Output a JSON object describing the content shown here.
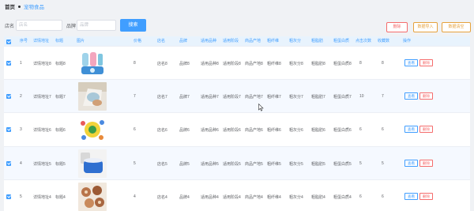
{
  "breadcrumb": {
    "home": "首页",
    "current": "宠物食品"
  },
  "search": {
    "label1": "店名",
    "placeholder1": "店名",
    "label2": "品牌",
    "placeholder2": "品牌",
    "button": "搜索"
  },
  "toolbar": {
    "delete": "删除",
    "import": "数据导入",
    "clear": "数据清空"
  },
  "columns": [
    "序号",
    "详情地址",
    "标题",
    "图片",
    "价格",
    "店名",
    "品牌",
    "适用品种",
    "适用阶段",
    "商品产地",
    "粗纤维",
    "粗灰分",
    "粗脂肪",
    "粗蛋白质",
    "点击次数",
    "收藏数",
    "操作"
  ],
  "actions": {
    "view": "查看",
    "delete": "删除"
  },
  "rows": [
    {
      "index": "1",
      "address": "详情地址8",
      "title": "标题8",
      "price": "8",
      "shop": "店名8",
      "brand": "品牌8",
      "breed": "适用品种8",
      "stage": "适用阶段8",
      "origin": "商品产地8",
      "fiber": "粗纤维8",
      "ash": "粗灰分8",
      "fat": "粗脂肪8",
      "protein": "粗蛋白质8",
      "clicks": "8",
      "favorites": "8"
    },
    {
      "index": "2",
      "address": "详情地址7",
      "title": "标题7",
      "price": "7",
      "shop": "店名7",
      "brand": "品牌7",
      "breed": "适用品种7",
      "stage": "适用阶段7",
      "origin": "商品产地7",
      "fiber": "粗纤维7",
      "ash": "粗灰分7",
      "fat": "粗脂肪7",
      "protein": "粗蛋白质7",
      "clicks": "10",
      "favorites": "7"
    },
    {
      "index": "3",
      "address": "详情地址6",
      "title": "标题6",
      "price": "6",
      "shop": "店名6",
      "brand": "品牌6",
      "breed": "适用品种6",
      "stage": "适用阶段6",
      "origin": "商品产地6",
      "fiber": "粗纤维6",
      "ash": "粗灰分6",
      "fat": "粗脂肪6",
      "protein": "粗蛋白质6",
      "clicks": "6",
      "favorites": "6"
    },
    {
      "index": "4",
      "address": "详情地址5",
      "title": "标题5",
      "price": "5",
      "shop": "店名5",
      "brand": "品牌5",
      "breed": "适用品种5",
      "stage": "适用阶段5",
      "origin": "商品产地5",
      "fiber": "粗纤维5",
      "ash": "粗灰分5",
      "fat": "粗脂肪5",
      "protein": "粗蛋白质5",
      "clicks": "5",
      "favorites": "5"
    },
    {
      "index": "5",
      "address": "详情地址4",
      "title": "标题4",
      "price": "4",
      "shop": "店名4",
      "brand": "品牌4",
      "breed": "适用品种4",
      "stage": "适用阶段4",
      "origin": "商品产地4",
      "fiber": "粗纤维4",
      "ash": "粗灰分4",
      "fat": "粗脂肪4",
      "protein": "粗蛋白质4",
      "clicks": "6",
      "favorites": "6"
    }
  ],
  "colors": {
    "accent": "#409eff",
    "danger": "#f56c6c",
    "warning": "#e6a23c",
    "header_bg": "#e8f3fd"
  }
}
